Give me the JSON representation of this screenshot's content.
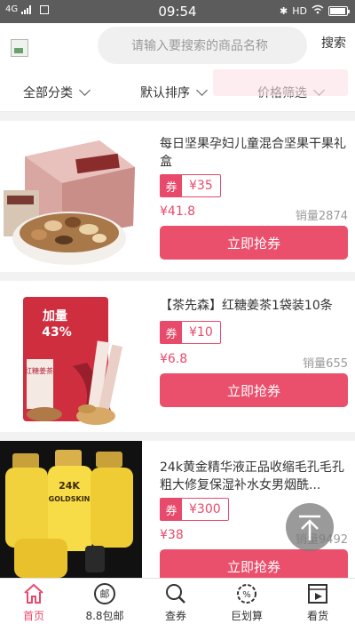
{
  "status_bar": {
    "network": "4G",
    "time": "09:54",
    "hd": "HD"
  },
  "header": {
    "search_placeholder": "请输入要搜索的商品名称",
    "search_button": "搜索"
  },
  "filters": [
    {
      "label": "全部分类"
    },
    {
      "label": "默认排序"
    },
    {
      "label": "价格筛选"
    }
  ],
  "products": [
    {
      "title": "每日坚果孕妇儿童混合坚果干果礼盒",
      "coupon_tag": "券",
      "coupon_value": "¥35",
      "price": "¥41.8",
      "sales": "销量2874",
      "button": "立即抢券"
    },
    {
      "title": "【茶先森】红糖姜茶1袋装10条",
      "coupon_tag": "券",
      "coupon_value": "¥10",
      "price": "¥6.8",
      "sales": "销量655",
      "button": "立即抢券",
      "image_text_1": "加量",
      "image_text_2": "43%",
      "image_text_3": "红糖姜茶"
    },
    {
      "title": "24k黄金精华液正品收缩毛孔毛孔粗大修复保湿补水女男烟酰...",
      "coupon_tag": "券",
      "coupon_value": "¥300",
      "price": "¥38",
      "sales": "销量9492",
      "button": "立即抢券",
      "image_text_1": "24K",
      "image_text_2": "GOLDSKIN"
    }
  ],
  "bottom_nav": [
    {
      "label": "首页",
      "icon": "home-icon",
      "active": true
    },
    {
      "label": "8.8包邮",
      "icon": "mail-stamp-icon"
    },
    {
      "label": "查券",
      "icon": "search-icon"
    },
    {
      "label": "巨划算",
      "icon": "discount-gear-icon"
    },
    {
      "label": "看货",
      "icon": "video-icon"
    }
  ],
  "colors": {
    "accent": "#e84a6b",
    "status_bar": "#5c5c5c"
  }
}
